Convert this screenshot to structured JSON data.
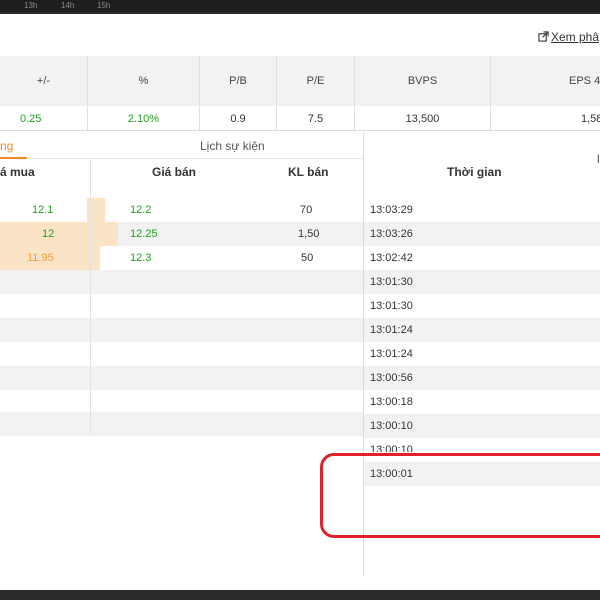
{
  "timeline": {
    "ticks": [
      "13h",
      "14h",
      "15h"
    ]
  },
  "link": {
    "label": "Xem phâ"
  },
  "metrics": {
    "headers": [
      "+/-",
      "%",
      "P/B",
      "P/E",
      "BVPS",
      "EPS 4"
    ],
    "values": [
      "0.25",
      "2.10%",
      "0.9",
      "7.5",
      "13,500",
      "1,58"
    ]
  },
  "tabs": {
    "active": "ng",
    "events": "Lịch sự kiện",
    "right_partial": "l"
  },
  "orderbook": {
    "headers": {
      "bid_price": "á mua",
      "ask_price": "Giá bán",
      "ask_vol": "KL bán"
    },
    "rows": [
      {
        "bid": "12.1",
        "ask": "12.2",
        "ask_vol": "70"
      },
      {
        "bid": "12",
        "ask": "12.25",
        "ask_vol": "1,50"
      },
      {
        "bid": "11.95",
        "ask": "12.3",
        "ask_vol": "50"
      }
    ]
  },
  "trades": {
    "header": "Thời gian",
    "times": [
      "13:03:29",
      "13:03:26",
      "13:02:42",
      "13:01:30",
      "13:01:30",
      "13:01:24",
      "13:01:24",
      "13:00:56",
      "13:00:18",
      "13:00:10",
      "13:00:10",
      "13:00:01"
    ]
  },
  "colors": {
    "accent": "#f08c1d",
    "up": "#1fa21f",
    "highlight": "#e0202a"
  }
}
